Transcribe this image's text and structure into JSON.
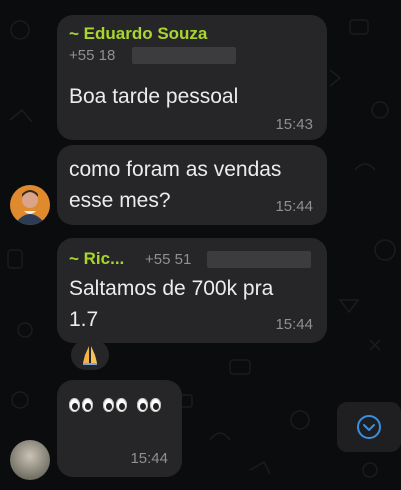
{
  "messages": [
    {
      "sender": "~ Eduardo Souza",
      "phone_prefix": "+55 18",
      "text": "Boa tarde pessoal",
      "time": "15:43"
    },
    {
      "text_line1": "como foram as vendas",
      "text_line2": "esse mes?",
      "time": "15:44"
    },
    {
      "sender": "~ Ric...",
      "phone_prefix": "+55 51",
      "text_line1": "Saltamos de 700k pra",
      "text_line2": "1.7",
      "time": "15:44",
      "reaction_icon": "folded-hands-icon"
    },
    {
      "content_icon": "eyes-emoji-icon",
      "eyes_count": 3,
      "time": "15:44"
    }
  ],
  "colors": {
    "background": "#0b0c0e",
    "bubble": "#262628",
    "sender_name": "#a9d52f",
    "scroll_icon": "#3a8fe0"
  },
  "icons": {
    "scroll_down": "chevron-down-circle-icon"
  }
}
